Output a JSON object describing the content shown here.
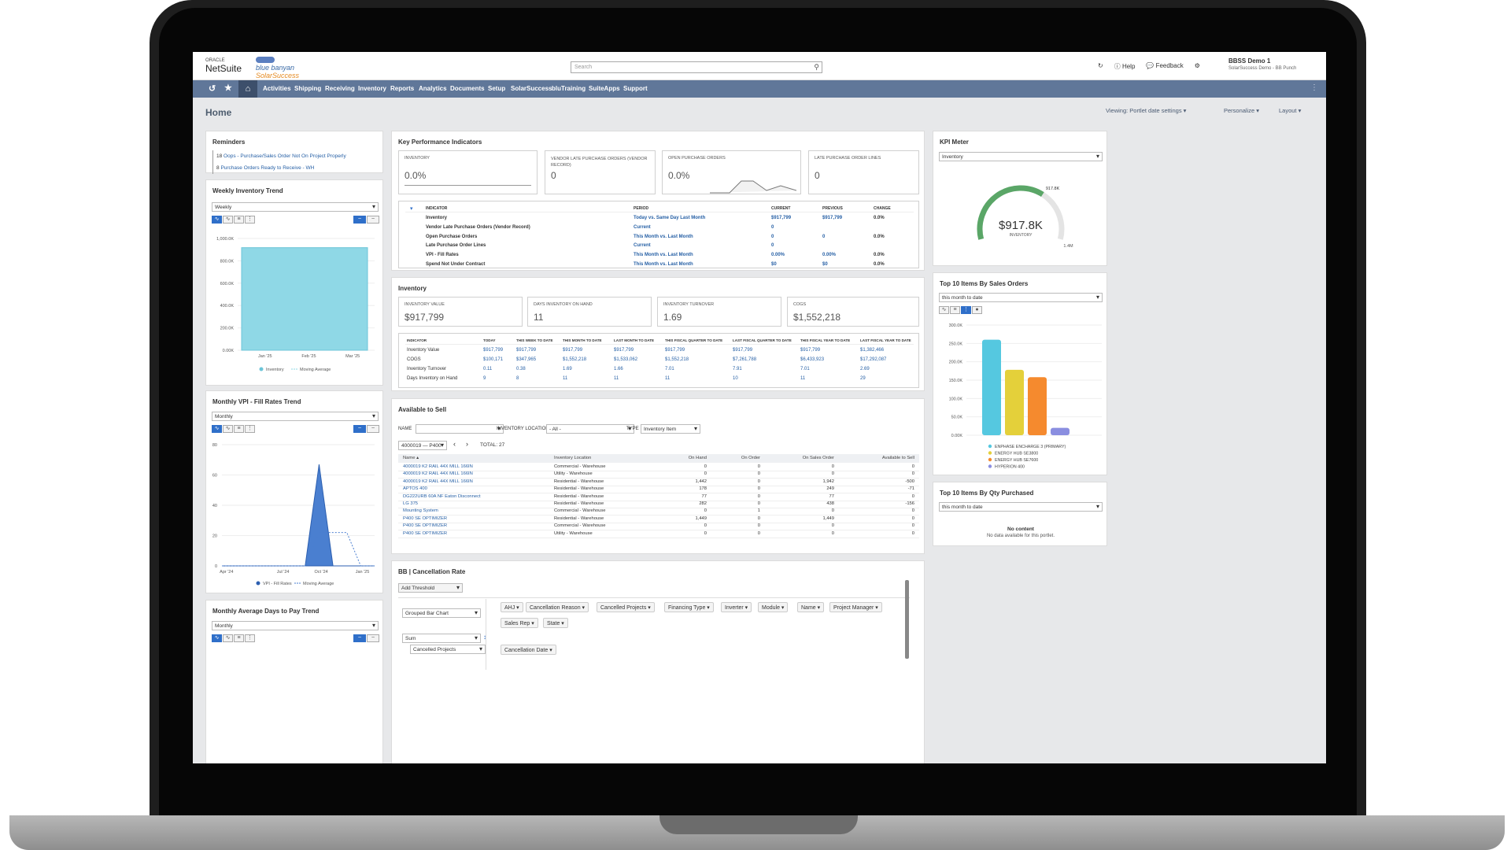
{
  "header": {
    "search_placeholder": "Search",
    "help": "Help",
    "feedback": "Feedback",
    "user_name": "BBSS Demo 1",
    "user_sub": "SolarSuccess Demo - BB Punch",
    "logo_oracle": "ORACLE",
    "logo_netsuite": "NetSuite",
    "logo_bluebanyan": "blue banyan",
    "logo_solarsuccess": "SolarSuccess"
  },
  "nav": [
    "Activities",
    "Shipping",
    "Receiving",
    "Inventory",
    "Reports",
    "Analytics",
    "Documents",
    "Setup",
    "SolarSuccess",
    "bluTraining",
    "SuiteApps",
    "Support"
  ],
  "page": {
    "title": "Home",
    "viewing": "Viewing: Portlet date settings ▾",
    "personalize": "Personalize ▾",
    "layout": "Layout ▾"
  },
  "reminders": {
    "title": "Reminders",
    "items": [
      {
        "count": "18",
        "text": "Oops - Purchase/Sales Order Not On Project Properly"
      },
      {
        "count": "8",
        "text": "Purchase Orders Ready to Receive - WH"
      }
    ]
  },
  "weekly": {
    "title": "Weekly Inventory Trend",
    "select": "Weekly",
    "legend": [
      "Inventory",
      "Moving Average"
    ],
    "chart_data": {
      "type": "area",
      "x": [
        "Jan '25",
        "Feb '25",
        "Mar '25"
      ],
      "series": [
        {
          "name": "Inventory",
          "values": [
            917799,
            917799,
            917799
          ]
        }
      ],
      "yticks": [
        "1,000.0K",
        "800.0K",
        "600.0K",
        "400.0K",
        "200.0K",
        "0.00K"
      ],
      "ylim": [
        0,
        1000000
      ]
    }
  },
  "monthly_vpi": {
    "title": "Monthly VPI - Fill Rates Trend",
    "select": "Monthly",
    "legend": [
      "VPI - Fill Rates",
      "Moving Average"
    ],
    "chart_data": {
      "type": "area",
      "x": [
        "Apr '24",
        "Jul '24",
        "Oct '24",
        "Jan '25"
      ],
      "series": [
        {
          "name": "VPI - Fill Rates",
          "values": [
            0,
            0,
            0,
            0,
            0,
            0,
            0,
            67,
            0,
            0,
            0,
            0
          ]
        },
        {
          "name": "Moving Average",
          "values": [
            0,
            0,
            0,
            0,
            0,
            0,
            0,
            22,
            22,
            22,
            0,
            0
          ]
        }
      ],
      "yticks": [
        "80",
        "60",
        "40",
        "20",
        "0"
      ],
      "ylim": [
        0,
        80
      ]
    }
  },
  "monthly_days": {
    "title": "Monthly Average Days to Pay Trend",
    "select": "Monthly"
  },
  "kpi": {
    "title": "Key Performance Indicators",
    "tiles": [
      {
        "label": "INVENTORY",
        "value": "0.0%"
      },
      {
        "label": "VENDOR LATE PURCHASE ORDERS (VENDOR RECORD)",
        "value": "0"
      },
      {
        "label": "OPEN PURCHASE ORDERS",
        "value": "0.0%"
      },
      {
        "label": "LATE PURCHASE ORDER LINES",
        "value": "0"
      }
    ],
    "headers": [
      "INDICATOR",
      "PERIOD",
      "CURRENT",
      "PREVIOUS",
      "CHANGE"
    ],
    "rows": [
      {
        "ind": "Inventory",
        "period": "Today vs. Same Day Last Month",
        "cur": "$917,799",
        "prev": "$917,799",
        "chg": "0.0%"
      },
      {
        "ind": "Vendor Late Purchase Orders (Vendor Record)",
        "period": "Current",
        "cur": "0",
        "prev": "",
        "chg": ""
      },
      {
        "ind": "Open Purchase Orders",
        "period": "This Month vs. Last Month",
        "cur": "0",
        "prev": "0",
        "chg": "0.0%"
      },
      {
        "ind": "Late Purchase Order Lines",
        "period": "Current",
        "cur": "0",
        "prev": "",
        "chg": ""
      },
      {
        "ind": "VPI - Fill Rates",
        "period": "This Month vs. Last Month",
        "cur": "0.00%",
        "prev": "0.00%",
        "chg": "0.0%"
      },
      {
        "ind": "Spend Not Under Contract",
        "period": "This Month vs. Last Month",
        "cur": "$0",
        "prev": "$0",
        "chg": "0.0%"
      }
    ]
  },
  "inventory": {
    "title": "Inventory",
    "tiles": [
      {
        "label": "INVENTORY VALUE",
        "value": "$917,799"
      },
      {
        "label": "DAYS INVENTORY ON HAND",
        "value": "11"
      },
      {
        "label": "INVENTORY TURNOVER",
        "value": "1.69"
      },
      {
        "label": "COGS",
        "value": "$1,552,218"
      }
    ],
    "headers": [
      "INDICATOR",
      "TODAY",
      "THIS WEEK TO DATE",
      "THIS MONTH TO DATE",
      "LAST MONTH TO DATE",
      "THIS FISCAL QUARTER TO DATE",
      "LAST FISCAL QUARTER TO DATE",
      "THIS FISCAL YEAR TO DATE",
      "LAST FISCAL YEAR TO DATE"
    ],
    "rows": [
      [
        "Inventory Value",
        "$917,799",
        "$917,799",
        "$917,799",
        "$917,799",
        "$917,799",
        "$917,799",
        "$917,799",
        "$1,382,466"
      ],
      [
        "COGS",
        "$100,171",
        "$347,965",
        "$1,552,218",
        "$1,533,062",
        "$1,552,218",
        "$7,261,788",
        "$6,433,923",
        "$17,292,087"
      ],
      [
        "Inventory Turnover",
        "0.11",
        "0.38",
        "1.69",
        "1.66",
        "7.01",
        "7.91",
        "7.01",
        "2.69"
      ],
      [
        "Days Inventory on Hand",
        "9",
        "8",
        "11",
        "11",
        "11",
        "10",
        "11",
        "29"
      ]
    ]
  },
  "ats": {
    "title": "Available to Sell",
    "name_label": "NAME",
    "loc_label": "INVENTORY LOCATION",
    "loc_value": "- All -",
    "type_label": "TYPE",
    "type_value": "Inventory Item",
    "page_select": "4000019 — P400",
    "total": "TOTAL: 27",
    "headers": [
      "Name ▴",
      "Inventory Location",
      "On Hand",
      "On Order",
      "On Sales Order",
      "Available to Sell"
    ],
    "rows": [
      [
        "4000019 K2 RAIL 44X MILL 166IN",
        "Commercial - Warehouse",
        "0",
        "0",
        "0",
        "0"
      ],
      [
        "4000019 K2 RAIL 44X MILL 166IN",
        "Utility - Warehouse",
        "0",
        "0",
        "0",
        "0"
      ],
      [
        "4000019 K2 RAIL 44X MILL 166IN",
        "Residential - Warehouse",
        "1,442",
        "0",
        "1,942",
        "-500"
      ],
      [
        "APTOS 400",
        "Residential - Warehouse",
        "178",
        "0",
        "249",
        "-71"
      ],
      [
        "DG222URB 60A NF Eaton Disconnect",
        "Residential - Warehouse",
        "77",
        "0",
        "77",
        "0"
      ],
      [
        "LG 375",
        "Residential - Warehouse",
        "282",
        "0",
        "438",
        "-156"
      ],
      [
        "Mounting System",
        "Commercial - Warehouse",
        "0",
        "1",
        "0",
        "0"
      ],
      [
        "P400 SE OPTIMIZER",
        "Residential - Warehouse",
        "1,449",
        "0",
        "1,449",
        "0"
      ],
      [
        "P400 SE OPTIMIZER",
        "Commercial - Warehouse",
        "0",
        "0",
        "0",
        "0"
      ],
      [
        "P400 SE OPTIMIZER",
        "Utility - Warehouse",
        "0",
        "0",
        "0",
        "0"
      ]
    ]
  },
  "cancel": {
    "title": "BB | Cancellation Rate",
    "threshold": "Add Threshold",
    "chart_type": "Grouped Bar Chart",
    "agg": "Sum",
    "measure": "Cancelled Projects",
    "chips": [
      "AHJ",
      "Cancellation Reason",
      "Cancelled Projects",
      "Financing Type",
      "Inverter",
      "Module",
      "Name",
      "Project Manager",
      "Sales Rep",
      "State"
    ],
    "date_chip": "Cancellation Date"
  },
  "meter": {
    "title": "KPI Meter",
    "select": "Inventory",
    "value": "$917.8K",
    "label": "INVENTORY",
    "marker": "917.8K",
    "max": "1.4M",
    "fraction": 0.655
  },
  "top_sales": {
    "title": "Top 10 Items By Sales Orders",
    "select": "this month to date",
    "chart_data": {
      "type": "bar",
      "series": [
        {
          "name": "ENPHASE ENCHARGE 3 (PRIMARY)",
          "values": [
            260000
          ],
          "color": "#55c8e0"
        },
        {
          "name": "ENERGY HUB SE3800",
          "values": [
            178000
          ],
          "color": "#e4d03a"
        },
        {
          "name": "ENERGY HUB SE7600",
          "values": [
            158000
          ],
          "color": "#f58a2e"
        },
        {
          "name": "HYPERION 400",
          "values": [
            20000
          ],
          "color": "#8a8ee0"
        }
      ],
      "yticks": [
        "300.0K",
        "250.0K",
        "200.0K",
        "150.0K",
        "100.0K",
        "50.0K",
        "0.00K"
      ],
      "ylim": [
        0,
        300000
      ]
    }
  },
  "top_qty": {
    "title": "Top 10 Items By Qty Purchased",
    "select": "this month to date",
    "empty_title": "No content",
    "empty_sub": "No data available for this portlet."
  }
}
